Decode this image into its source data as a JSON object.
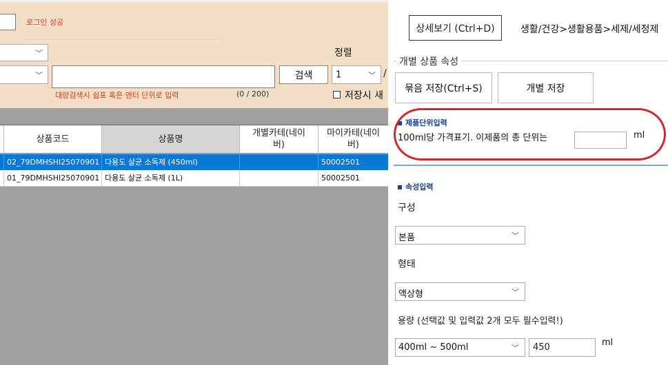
{
  "top": {
    "login_status": "로그인 성공",
    "sort_label": "정렬",
    "sort_value": "1",
    "slash": "/",
    "search_button": "검색",
    "search_hint": "대량검색시 쉼표 혹은 엔터 단위로 입력",
    "search_counter": "(0 / 200)",
    "save_checkbox_label": "저장시 새"
  },
  "grid": {
    "columns": [
      "상품코드",
      "상품명",
      "개별카테(네이버)",
      "마이카테(네이버)"
    ],
    "rows": [
      {
        "code": "02_79DMHSHI25070901",
        "name": "다용도 살균 소독제 (450ml)",
        "cat": "",
        "mycat": "50002501"
      },
      {
        "code": "01_79DMHSHI25070901",
        "name": "다용도 살균 소독제 (1L)",
        "cat": "",
        "mycat": "50002501"
      }
    ]
  },
  "detail": {
    "detail_button": "상세보기 (Ctrl+D)",
    "breadcrumb": "생활/건강>생활용품>세제/세정제",
    "section_title": "개별 상품 속성",
    "bundle_save_button": "묶음 저장(Ctrl+S)",
    "individual_save_button": "개별 저장",
    "unit_title": "제품단위입력",
    "unit_label": "100ml당 가격표기. 이제품의 총 단위는",
    "unit_ml": "ml",
    "attr_title": "속성입력",
    "composition_label": "구성",
    "composition_value": "본품",
    "form_label": "형태",
    "form_value": "액상형",
    "capacity_label": "용량 (선택값 및 입력값 2개 모두 필수입력!)",
    "capacity_value": "400ml ~ 500ml",
    "capacity_input": "450",
    "capacity_ml": "ml"
  }
}
